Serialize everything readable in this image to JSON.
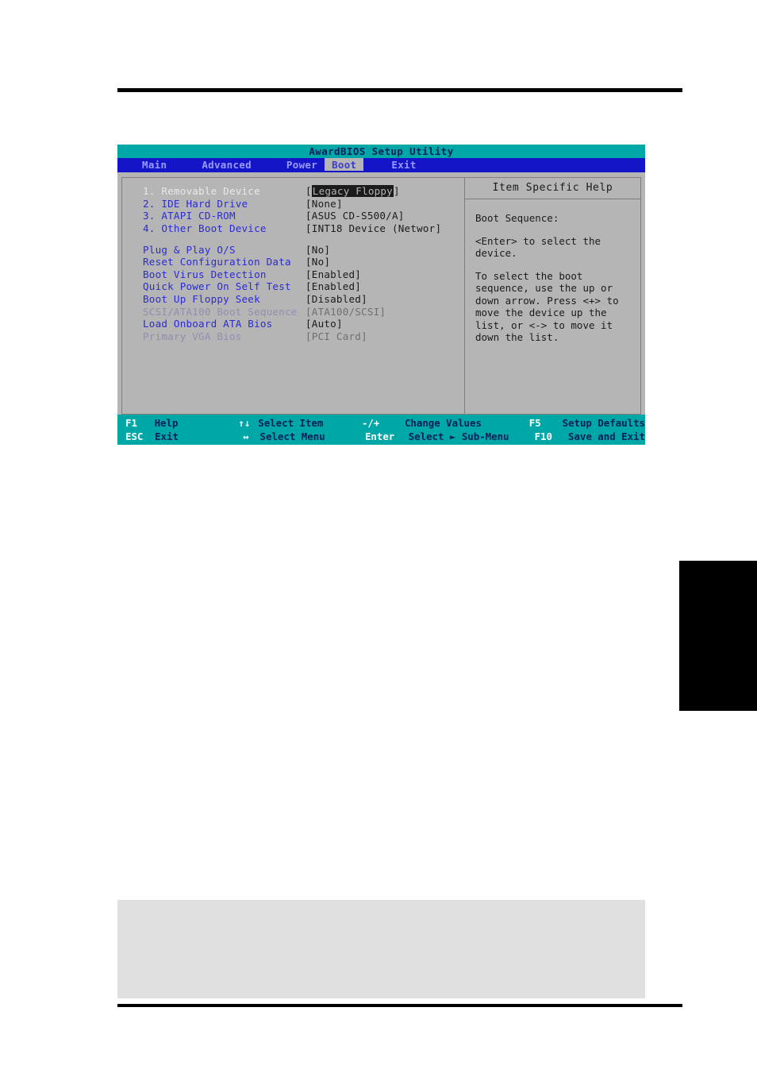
{
  "window": {
    "title": "AwardBIOS Setup Utility",
    "tabs": [
      {
        "label": "Main",
        "active": false
      },
      {
        "label": "Advanced",
        "active": false
      },
      {
        "label": "Power",
        "active": false
      },
      {
        "label": "Boot",
        "active": true
      },
      {
        "label": "Exit",
        "active": false
      }
    ]
  },
  "boot_sequence": [
    {
      "label": "1. Removable Device",
      "value": "Legacy Floppy",
      "selected": true,
      "dim": false
    },
    {
      "label": "2. IDE Hard Drive",
      "value": "None",
      "selected": false,
      "dim": false
    },
    {
      "label": "3. ATAPI CD-ROM",
      "value": "ASUS CD-S500/A",
      "selected": false,
      "dim": false
    },
    {
      "label": "4. Other Boot Device",
      "value": "INT18 Device (Networ",
      "selected": false,
      "dim": false
    }
  ],
  "settings": [
    {
      "label": "Plug & Play O/S",
      "value": "No",
      "dim": false
    },
    {
      "label": "Reset Configuration Data",
      "value": "No",
      "dim": false
    },
    {
      "label": "Boot Virus Detection",
      "value": "Enabled",
      "dim": false
    },
    {
      "label": "Quick Power On Self Test",
      "value": "Enabled",
      "dim": false
    },
    {
      "label": "Boot Up Floppy Seek",
      "value": "Disabled",
      "dim": false
    },
    {
      "label": "SCSI/ATA100 Boot Sequence",
      "value": "ATA100/SCSI",
      "dim": true
    },
    {
      "label": "Load Onboard ATA Bios",
      "value": "Auto",
      "dim": false
    },
    {
      "label": "Primary VGA Bios",
      "value": "PCI Card",
      "dim": true
    }
  ],
  "help": {
    "title": "Item Specific Help",
    "paragraphs": [
      "Boot Sequence:",
      "<Enter> to select the\ndevice.",
      "To select the boot\nsequence, use the up or\ndown arrow. Press <+> to\nmove the device up the\nlist, or <-> to move it\ndown the list."
    ]
  },
  "footer": {
    "row1": {
      "key1": "F1",
      "desc1": "Help",
      "key2": "↑↓",
      "desc2": "Select Item",
      "key3": "-/+",
      "desc3": "Change Values",
      "key4": "F5",
      "desc4": "Setup Defaults"
    },
    "row2": {
      "key1": "ESC",
      "desc1": "Exit",
      "key2": "↔",
      "desc2": "Select Menu",
      "key3": "Enter",
      "desc3": "Select ► Sub-Menu",
      "key4": "F10",
      "desc4": "Save and Exit"
    }
  },
  "colors": {
    "titlebar": "#00a7a7",
    "menubar": "#1414c8",
    "panel": "#b5b5b5",
    "label": "#2b2bd4",
    "note_box": "#e0e0e0"
  }
}
